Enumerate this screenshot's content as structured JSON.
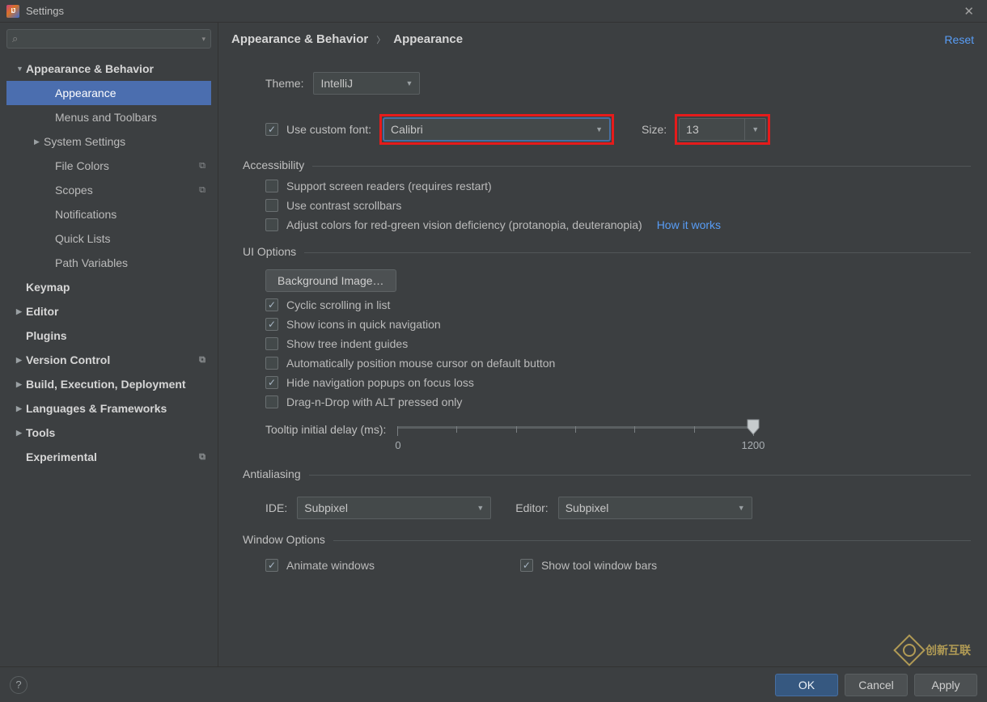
{
  "window": {
    "title": "Settings"
  },
  "search": {
    "placeholder": ""
  },
  "sidebar": [
    {
      "label": "Appearance & Behavior",
      "level": 0,
      "expanded": true
    },
    {
      "label": "Appearance",
      "level": 1,
      "selected": true
    },
    {
      "label": "Menus and Toolbars",
      "level": 1
    },
    {
      "label": "System Settings",
      "level": 1,
      "expandable": true,
      "arrow": true
    },
    {
      "label": "File Colors",
      "level": 1,
      "tag": true
    },
    {
      "label": "Scopes",
      "level": 1,
      "tag": true
    },
    {
      "label": "Notifications",
      "level": 1
    },
    {
      "label": "Quick Lists",
      "level": 1
    },
    {
      "label": "Path Variables",
      "level": 1
    },
    {
      "label": "Keymap",
      "level": 0,
      "noarrow": true
    },
    {
      "label": "Editor",
      "level": 0
    },
    {
      "label": "Plugins",
      "level": 0,
      "noarrow": true
    },
    {
      "label": "Version Control",
      "level": 0,
      "tag": true
    },
    {
      "label": "Build, Execution, Deployment",
      "level": 0
    },
    {
      "label": "Languages & Frameworks",
      "level": 0
    },
    {
      "label": "Tools",
      "level": 0
    },
    {
      "label": "Experimental",
      "level": 0,
      "noarrow": true,
      "tag": true
    }
  ],
  "breadcrumb": {
    "a": "Appearance & Behavior",
    "b": "Appearance"
  },
  "reset": "Reset",
  "theme": {
    "label": "Theme:",
    "value": "IntelliJ"
  },
  "font": {
    "check_label": "Use custom font:",
    "checked": true,
    "value": "Calibri",
    "size_label": "Size:",
    "size_value": "13"
  },
  "accessibility": {
    "legend": "Accessibility",
    "screen_readers": {
      "label": "Support screen readers (requires restart)",
      "checked": false
    },
    "contrast_scroll": {
      "label": "Use contrast scrollbars",
      "checked": false
    },
    "adjust_colors": {
      "label": "Adjust colors for red-green vision deficiency (protanopia, deuteranopia)",
      "checked": false,
      "link": "How it works"
    }
  },
  "ui_options": {
    "legend": "UI Options",
    "bg_image_btn": "Background Image…",
    "cyclic": {
      "label": "Cyclic scrolling in list",
      "checked": true
    },
    "icons_nav": {
      "label": "Show icons in quick navigation",
      "checked": true
    },
    "tree_ind": {
      "label": "Show tree indent guides",
      "checked": false
    },
    "auto_mouse": {
      "label": "Automatically position mouse cursor on default button",
      "checked": false
    },
    "hide_nav": {
      "label": "Hide navigation popups on focus loss",
      "checked": true
    },
    "dnd_alt": {
      "label": "Drag-n-Drop with ALT pressed only",
      "checked": false
    },
    "tooltip": {
      "label": "Tooltip initial delay (ms):",
      "min": 0,
      "max": 1200,
      "value": 1200
    }
  },
  "antialiasing": {
    "legend": "Antialiasing",
    "ide": {
      "label": "IDE:",
      "value": "Subpixel"
    },
    "editor": {
      "label": "Editor:",
      "value": "Subpixel"
    }
  },
  "window_options": {
    "legend": "Window Options",
    "animate": {
      "label": "Animate windows",
      "checked": true
    },
    "show_tool": {
      "label": "Show tool window bars",
      "checked": true
    }
  },
  "footer": {
    "ok": "OK",
    "cancel": "Cancel",
    "apply": "Apply"
  },
  "watermark": "创新互联"
}
